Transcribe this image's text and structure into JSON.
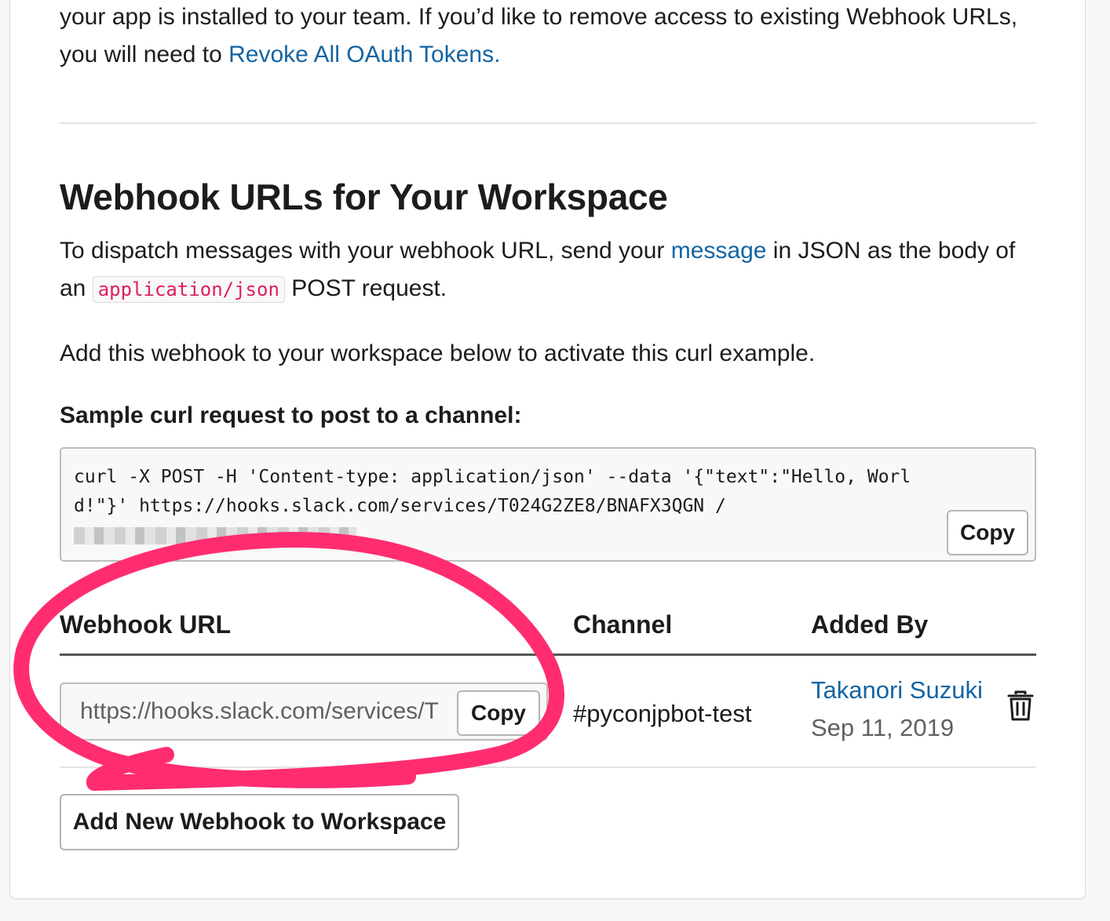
{
  "intro": {
    "text_before_link": "your app is installed to your team. If you’d like to remove access to existing Webhook URLs, you will need to ",
    "link_text": "Revoke All OAuth Tokens."
  },
  "section": {
    "title": "Webhook URLs for Your Workspace",
    "desc_part1": "To dispatch messages with your webhook URL, send your ",
    "desc_link": "message",
    "desc_part2": " in JSON as the body of an ",
    "desc_code": "application/json",
    "desc_part3": " POST request.",
    "activate_text": "Add this webhook to your workspace below to activate this curl example."
  },
  "sample": {
    "label": "Sample curl request to post to a channel:",
    "code": "curl -X POST -H 'Content-type: application/json' --data '{\"text\":\"Hello, World!\"}' https://hooks.slack.com/services/T024G2ZE8/BNAFX3QGN ",
    "redacted_prefix": "/",
    "copy_label": "Copy"
  },
  "table": {
    "headers": [
      "Webhook URL",
      "Channel",
      "Added By"
    ],
    "rows": [
      {
        "url": "https://hooks.slack.com/services/T",
        "copy_label": "Copy",
        "channel": "#pyconjpbot-test",
        "added_by": "Takanori Suzuki",
        "date": "Sep 11, 2019"
      }
    ]
  },
  "actions": {
    "add_webhook_label": "Add New Webhook to Workspace"
  },
  "icons": {
    "delete": "trash-icon"
  },
  "colors": {
    "link": "#1264a3",
    "code_pink": "#e01e5a",
    "annotation": "#ff2d6f"
  }
}
